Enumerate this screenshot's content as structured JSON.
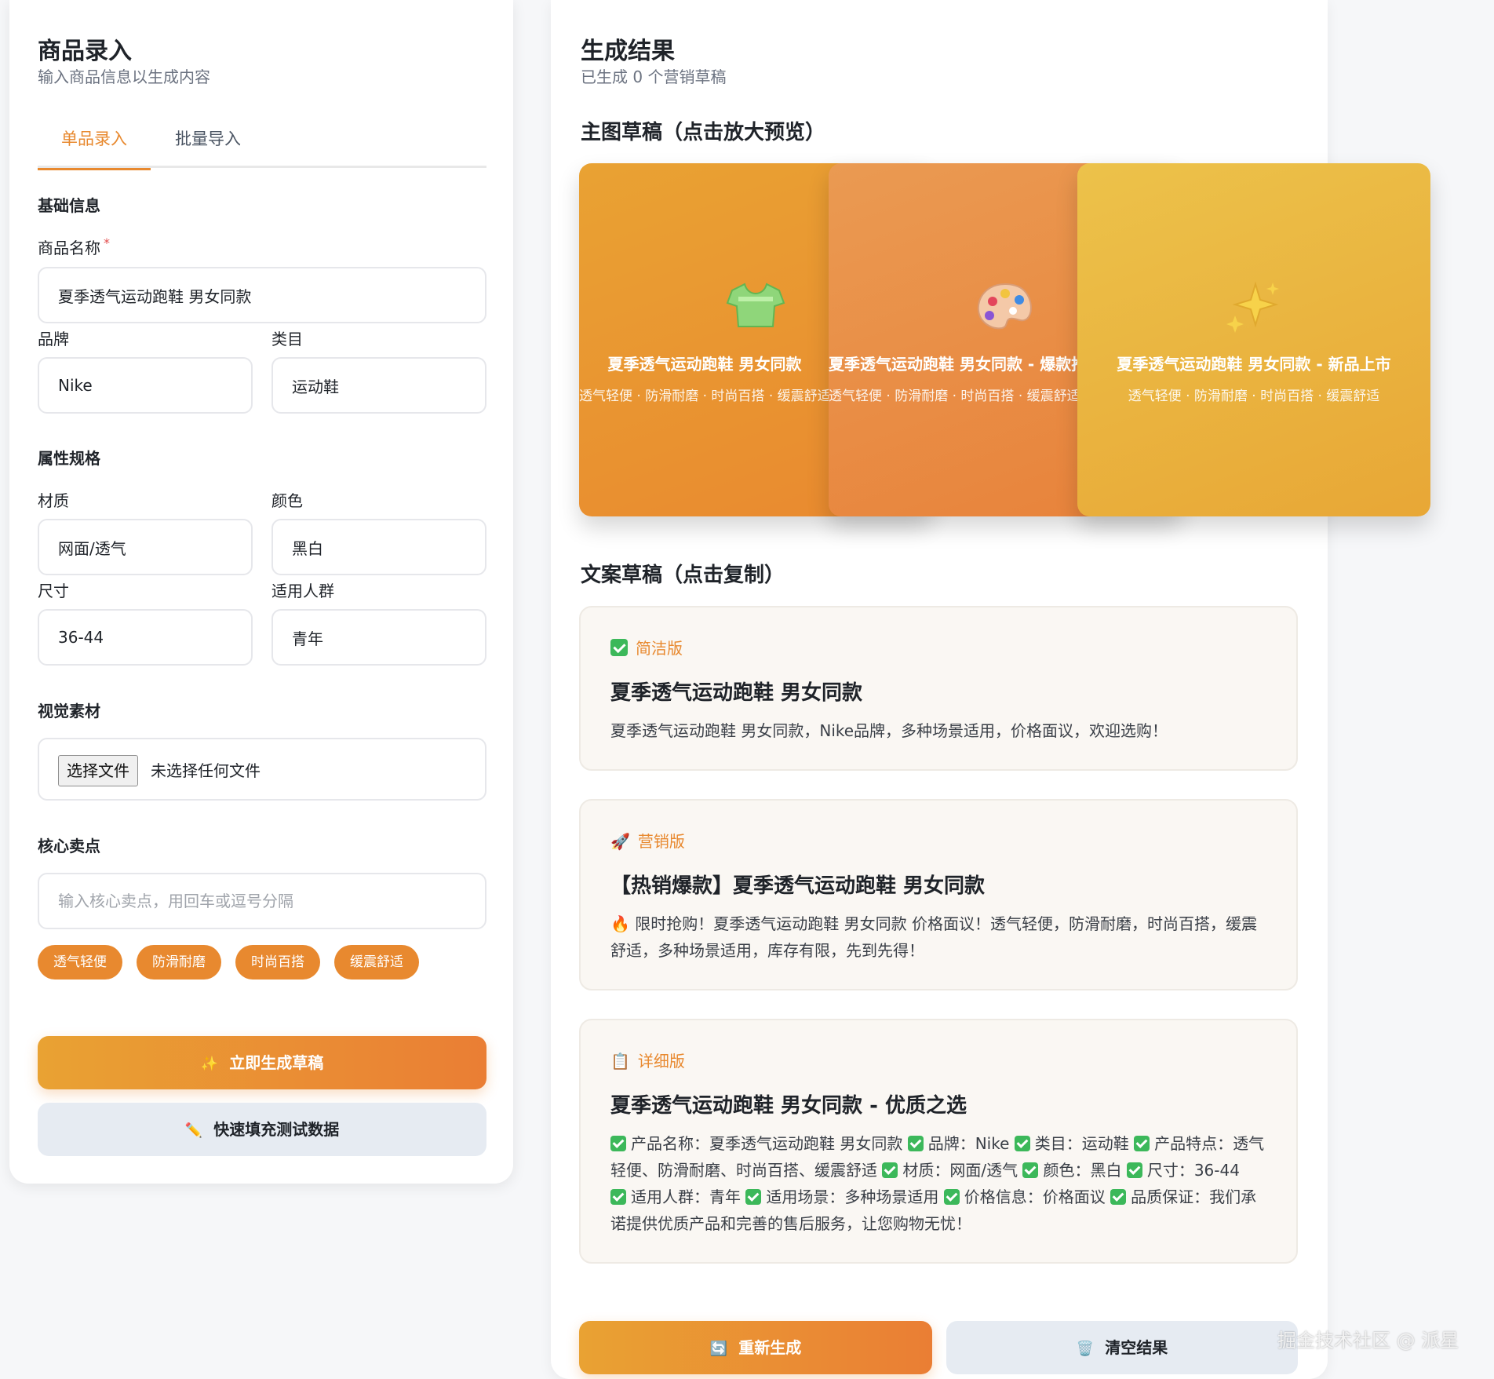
{
  "left": {
    "title": "商品录入",
    "subtitle": "输入商品信息以生成内容",
    "tabs": [
      {
        "label": "单品录入",
        "active": true
      },
      {
        "label": "批量导入",
        "active": false
      }
    ],
    "sections": {
      "basic": "基础信息",
      "attrs": "属性规格",
      "visual": "视觉素材",
      "selling": "核心卖点"
    },
    "fields": {
      "name": {
        "label": "商品名称",
        "required_mark": "*",
        "value": "夏季透气运动跑鞋 男女同款"
      },
      "brand": {
        "label": "品牌",
        "value": "Nike"
      },
      "category": {
        "label": "类目",
        "value": "运动鞋"
      },
      "material": {
        "label": "材质",
        "value": "网面/透气"
      },
      "color": {
        "label": "颜色",
        "value": "黑白"
      },
      "size": {
        "label": "尺寸",
        "value": "36-44"
      },
      "audience": {
        "label": "适用人群",
        "value": "青年"
      }
    },
    "file": {
      "button": "选择文件",
      "status": "未选择任何文件"
    },
    "selling_points": {
      "placeholder": "输入核心卖点，用回车或逗号分隔",
      "tags": [
        "透气轻便",
        "防滑耐磨",
        "时尚百搭",
        "缓震舒适"
      ]
    },
    "generate_button": {
      "icon": "✨",
      "label": "立即生成草稿"
    },
    "fill_button": {
      "icon": "✏️",
      "label": "快速填充测试数据"
    }
  },
  "right": {
    "title": "生成结果",
    "subtitle": "已生成 0 个营销草稿",
    "images_heading": "主图草稿（点击放大预览）",
    "cards": [
      {
        "icon": "👕",
        "title": "夏季透气运动跑鞋 男女同款",
        "desc": "透气轻便 · 防滑耐磨 · 时尚百搭 · 缓震舒适"
      },
      {
        "icon": "🎨",
        "title": "夏季透气运动跑鞋 男女同款 - 爆款推荐",
        "desc": "透气轻便 · 防滑耐磨 · 时尚百搭 · 缓震舒适"
      },
      {
        "icon": "✨",
        "title": "夏季透气运动跑鞋 男女同款 - 新品上市",
        "desc": "透气轻便 · 防滑耐磨 · 时尚百搭 · 缓震舒适"
      }
    ],
    "copy_heading": "文案草稿（点击复制）",
    "copies": [
      {
        "badge": "简洁版",
        "title": "夏季透气运动跑鞋 男女同款",
        "body": "夏季透气运动跑鞋 男女同款，Nike品牌，多种场景适用，价格面议，欢迎选购！"
      },
      {
        "badge": "营销版",
        "badge_icon": "🚀",
        "title": "【热销爆款】夏季透气运动跑鞋 男女同款",
        "body_icon": "🔥",
        "body": " 限时抢购！夏季透气运动跑鞋 男女同款 价格面议！透气轻便，防滑耐磨，时尚百搭，缓震舒适，多种场景适用，库存有限，先到先得！"
      },
      {
        "badge": "详细版",
        "badge_icon": "📋",
        "title": "夏季透气运动跑鞋 男女同款 - 优质之选",
        "details": [
          "产品名称：夏季透气运动跑鞋 男女同款",
          "品牌：Nike",
          "类目：运动鞋",
          "产品特点：透气轻便、防滑耐磨、时尚百搭、缓震舒适",
          "材质：网面/透气",
          "颜色：黑白",
          "尺寸：36-44",
          "适用人群：青年",
          "适用场景：多种场景适用",
          "价格信息：价格面议",
          "品质保证：我们承诺提供优质产品和完善的售后服务，让您购物无忧！"
        ]
      }
    ],
    "regenerate_button": {
      "icon": "🔄",
      "label": "重新生成"
    },
    "clear_button": {
      "icon": "🗑️",
      "label": "清空结果"
    }
  },
  "watermark": "掘金技术社区 @ 派星"
}
